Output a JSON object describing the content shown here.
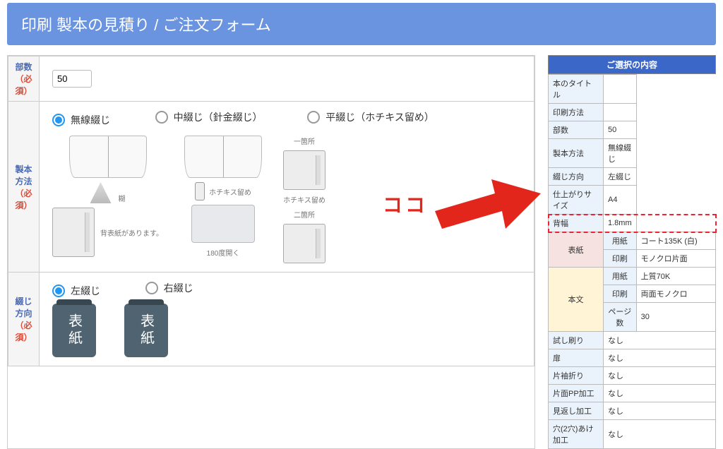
{
  "header": {
    "title": "印刷 製本の見積り / ご注文フォーム"
  },
  "required_label": "（必須）",
  "sections": {
    "quantity": {
      "label": "部数",
      "value": "50"
    },
    "binding": {
      "label": "製本方法",
      "options": [
        {
          "label": "無線綴じ",
          "selected": true
        },
        {
          "label": "中綴じ（針金綴じ）",
          "selected": false
        },
        {
          "label": "平綴じ（ホチキス留め）",
          "selected": false
        }
      ],
      "illus": {
        "col1a": "糊",
        "col1b": "背表紙があります。",
        "col2a": "ホチキス留め",
        "col2b": "180度開く",
        "col3a": "一箇所",
        "col3b": "ホチキス留め",
        "col3c": "二箇所"
      }
    },
    "direction": {
      "label": "綴じ方向",
      "options": [
        {
          "label": "左綴じ",
          "selected": true
        },
        {
          "label": "右綴じ",
          "selected": false
        }
      ],
      "book_text": "表紙"
    }
  },
  "callout": "ココ",
  "summary": {
    "title": "ご選択の内容",
    "rows_top": [
      {
        "k": "本のタイトル",
        "v": ""
      },
      {
        "k": "印刷方法",
        "v": ""
      },
      {
        "k": "部数",
        "v": "50"
      },
      {
        "k": "製本方法",
        "v": "無線綴じ"
      },
      {
        "k": "綴じ方向",
        "v": "左綴じ"
      },
      {
        "k": "仕上がりサイズ",
        "v": "A4"
      },
      {
        "k": "背幅",
        "v": "1.8mm"
      }
    ],
    "cover": {
      "group": "表紙",
      "rows": [
        {
          "k": "用紙",
          "v": "コート135K (白)"
        },
        {
          "k": "印刷",
          "v": "モノクロ片面"
        }
      ]
    },
    "body": {
      "group": "本文",
      "rows": [
        {
          "k": "用紙",
          "v": "上質70K"
        },
        {
          "k": "印刷",
          "v": "両面モノクロ"
        },
        {
          "k": "ページ数",
          "v": "30"
        }
      ]
    },
    "rows_bottom": [
      {
        "k": "試し刷り",
        "v": "なし"
      },
      {
        "k": "扉",
        "v": "なし"
      },
      {
        "k": "片袖折り",
        "v": "なし"
      },
      {
        "k": "片面PP加工",
        "v": "なし"
      },
      {
        "k": "見返し加工",
        "v": "なし"
      },
      {
        "k": "穴(2穴)あけ加工",
        "v": "なし"
      }
    ]
  }
}
